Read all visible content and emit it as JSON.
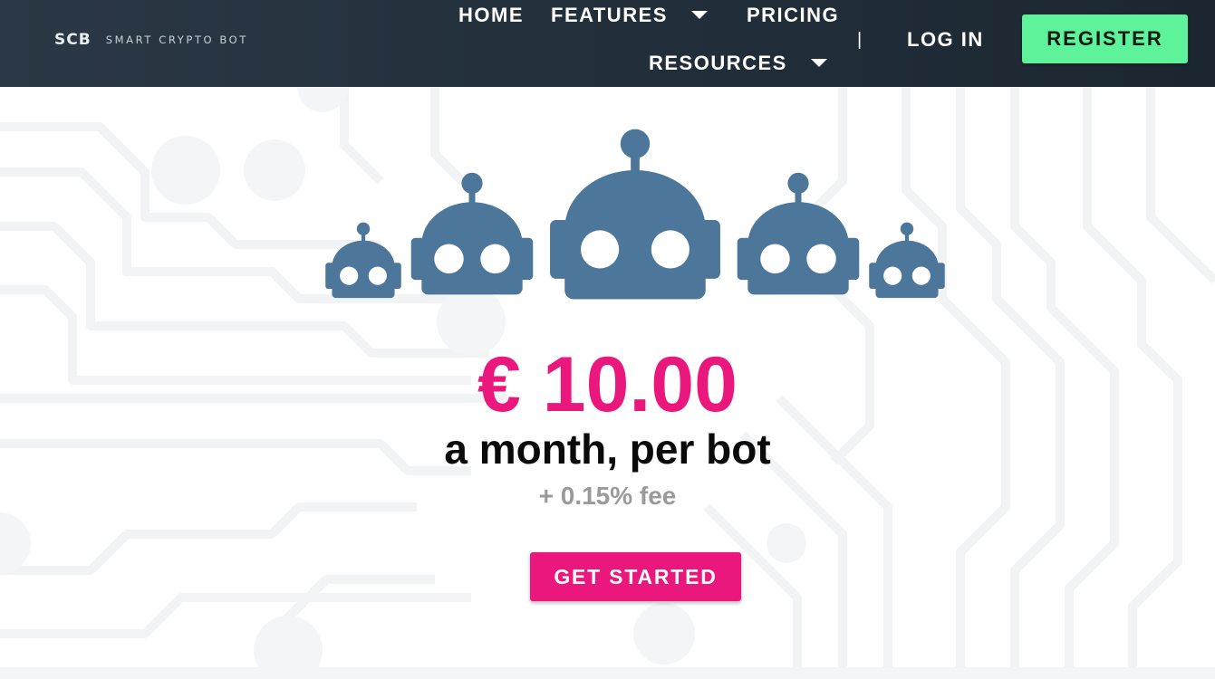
{
  "header": {
    "logo_mark": "SCB",
    "logo_text": "SMART CRYPTO BOT",
    "nav": {
      "home": "HOME",
      "features": "FEATURES",
      "pricing": "PRICING",
      "resources": "RESOURCES",
      "separator": "|",
      "login": "LOG IN",
      "register": "REGISTER"
    }
  },
  "hero": {
    "price": "€ 10.00",
    "period": "a month, per bot",
    "fee": "+ 0.15% fee",
    "cta": "GET STARTED"
  },
  "colors": {
    "header_bg": "#24313d",
    "register_bg": "#5ef39a",
    "accent_pink": "#ea177d",
    "robot_blue": "#4c779b",
    "fee_gray": "#9a9a9a"
  },
  "icons": {
    "robots": [
      "robot-icon",
      "robot-icon",
      "robot-icon",
      "robot-icon",
      "robot-icon"
    ],
    "dropdown": "caret-down-icon"
  }
}
